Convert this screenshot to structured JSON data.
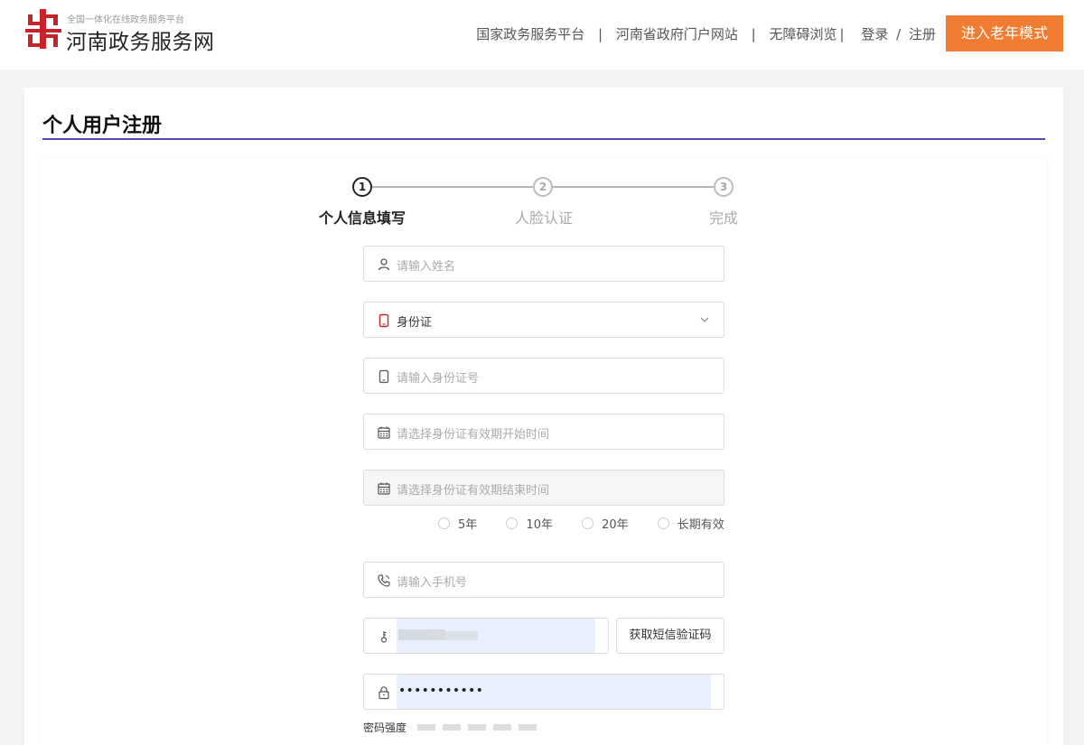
{
  "header": {
    "logo_subtitle": "全国一体化在线政务服务平台",
    "logo_title": "河南政务服务网",
    "nav": {
      "national": "国家政务服务平台",
      "separator": "|",
      "provincial": "河南省政府门户网站",
      "accessible": "无障碍浏览",
      "accessible_sep": "|",
      "login": "登录",
      "slash": "/",
      "register": "注册"
    },
    "elder_mode_label": "进入老年模式"
  },
  "colors": {
    "brand_red": "#c9232a",
    "accent_purple": "#5b45b8",
    "elder_orange": "#f07c32"
  },
  "page": {
    "title": "个人用户注册"
  },
  "steps": [
    {
      "number": "1",
      "label": "个人信息填写",
      "active": true
    },
    {
      "number": "2",
      "label": "人脸认证",
      "active": false
    },
    {
      "number": "3",
      "label": "完成",
      "active": false
    }
  ],
  "form": {
    "name_placeholder": "请输入姓名",
    "id_type_value": "身份证",
    "id_number_placeholder": "请输入身份证号",
    "valid_start_placeholder": "请选择身份证有效期开始时间",
    "valid_end_placeholder": "请选择身份证有效期结束时间",
    "validity_options": [
      "5年",
      "10年",
      "20年",
      "长期有效"
    ],
    "phone_placeholder": "请输入手机号",
    "sms_button_label": "获取短信验证码",
    "password_masked": "•••••••••••",
    "password_strength_label": "密码强度"
  },
  "icons": {
    "name": "user-icon",
    "id_type": "id-card-icon",
    "id_number": "tablet-icon",
    "date": "calendar-icon",
    "phone": "phone-icon",
    "sms": "key-icon",
    "password": "lock-icon",
    "dropdown": "chevron-down-icon"
  }
}
